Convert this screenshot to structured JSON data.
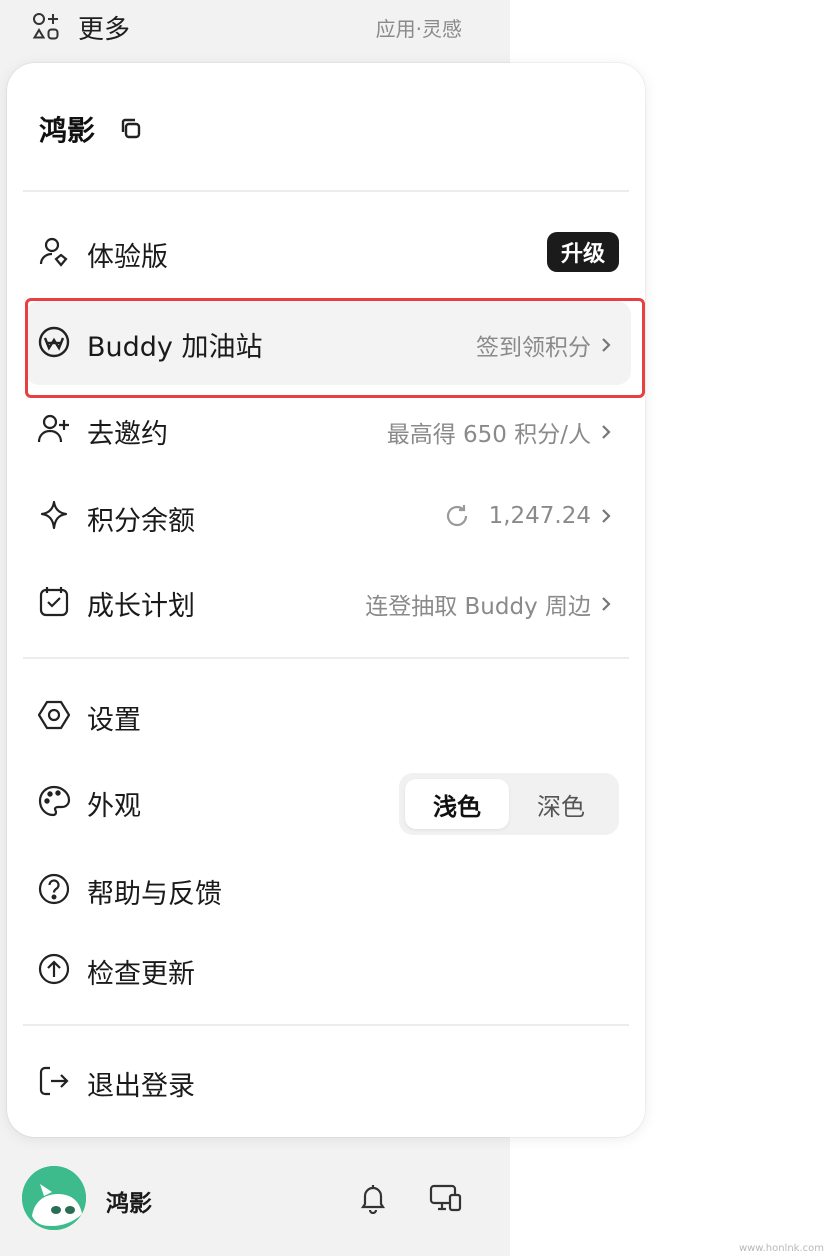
{
  "top_bar": {
    "title": "更多",
    "subtitle": "应用·灵感"
  },
  "user_menu": {
    "user_name": "鸿影",
    "plan": {
      "label": "体验版",
      "upgrade_label": "升级"
    },
    "buddy_station": {
      "label": "Buddy 加油站",
      "hint": "签到领积分"
    },
    "invite": {
      "label": "去邀约",
      "hint": "最高得 650 积分/人"
    },
    "points": {
      "label": "积分余额",
      "value": "1,247.24"
    },
    "growth": {
      "label": "成长计划",
      "hint": "连登抽取 Buddy 周边"
    },
    "settings": {
      "label": "设置"
    },
    "appearance": {
      "label": "外观",
      "options": [
        "浅色",
        "深色"
      ],
      "selected": "浅色"
    },
    "help": {
      "label": "帮助与反馈"
    },
    "update": {
      "label": "检查更新"
    },
    "logout": {
      "label": "退出登录"
    }
  },
  "bottom_bar": {
    "user_name": "鸿影"
  },
  "watermark": "www.honlnk.com",
  "colors": {
    "highlight_border": "#e84040",
    "upgrade_bg": "#1b1b1b",
    "avatar_bg": "#3dbb8c"
  }
}
